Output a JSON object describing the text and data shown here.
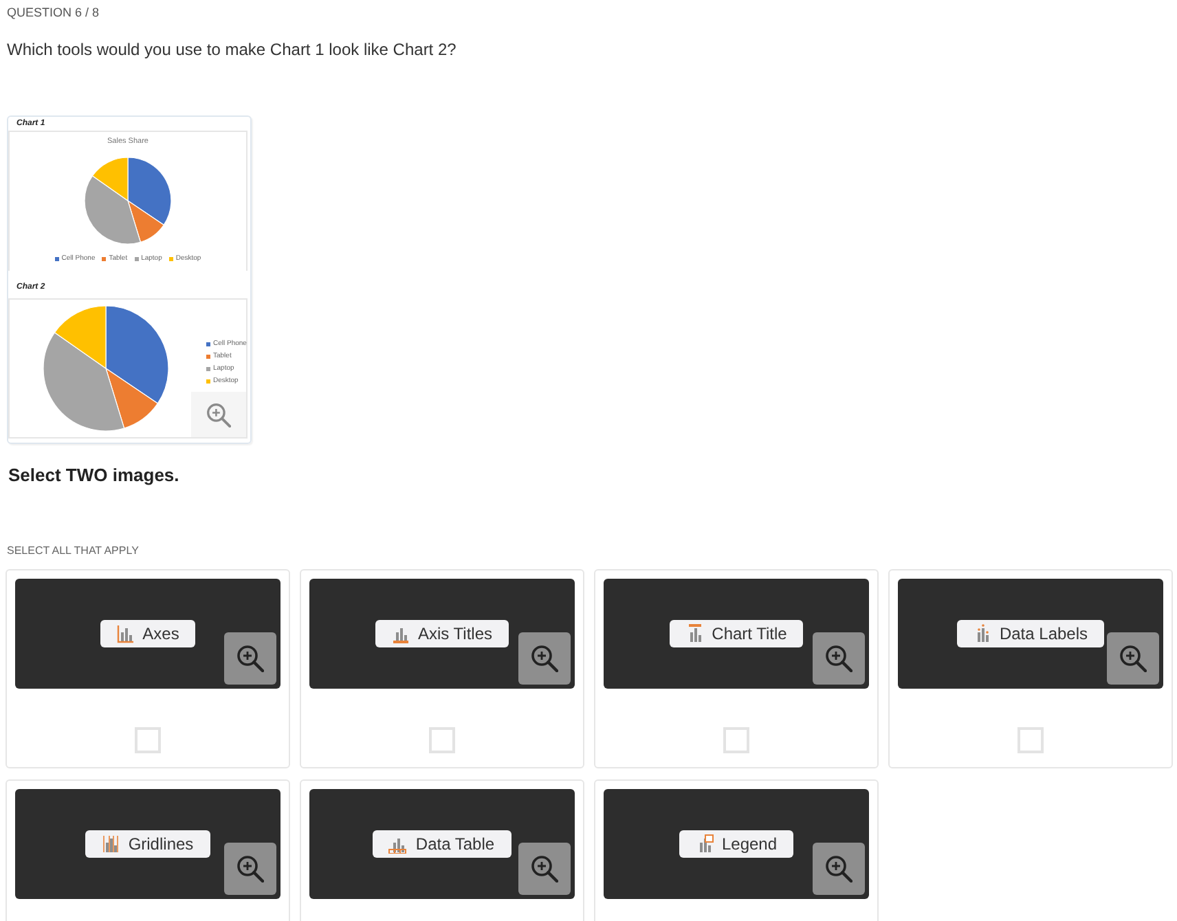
{
  "question": {
    "counter": "QUESTION 6 / 8",
    "prompt": "Which tools would you use to make Chart 1 look like Chart 2?"
  },
  "figure": {
    "charts": [
      {
        "label": "Chart 1",
        "title": "Sales Share",
        "kind": "below",
        "legend": [
          {
            "label": "Cell Phone",
            "color": "#4472c4"
          },
          {
            "label": "Tablet",
            "color": "#ed7d31"
          },
          {
            "label": "Laptop",
            "color": "#a5a5a5"
          },
          {
            "label": "Desktop",
            "color": "#ffc000"
          }
        ]
      },
      {
        "label": "Chart 2",
        "kind": "beside",
        "legend": [
          {
            "label": "Cell Phone",
            "color": "#4472c4"
          },
          {
            "label": "Tablet",
            "color": "#ed7d31"
          },
          {
            "label": "Laptop",
            "color": "#a5a5a5"
          },
          {
            "label": "Desktop",
            "color": "#ffc000"
          }
        ]
      }
    ]
  },
  "instruction": "Select TWO images.",
  "hint": "SELECT ALL THAT APPLY",
  "options": [
    {
      "label": "Axes",
      "checked": false
    },
    {
      "label": "Axis Titles",
      "checked": false
    },
    {
      "label": "Chart Title",
      "checked": false
    },
    {
      "label": "Data Labels",
      "checked": false
    },
    {
      "label": "Gridlines"
    },
    {
      "label": "Data Table"
    },
    {
      "label": "Legend"
    }
  ]
}
